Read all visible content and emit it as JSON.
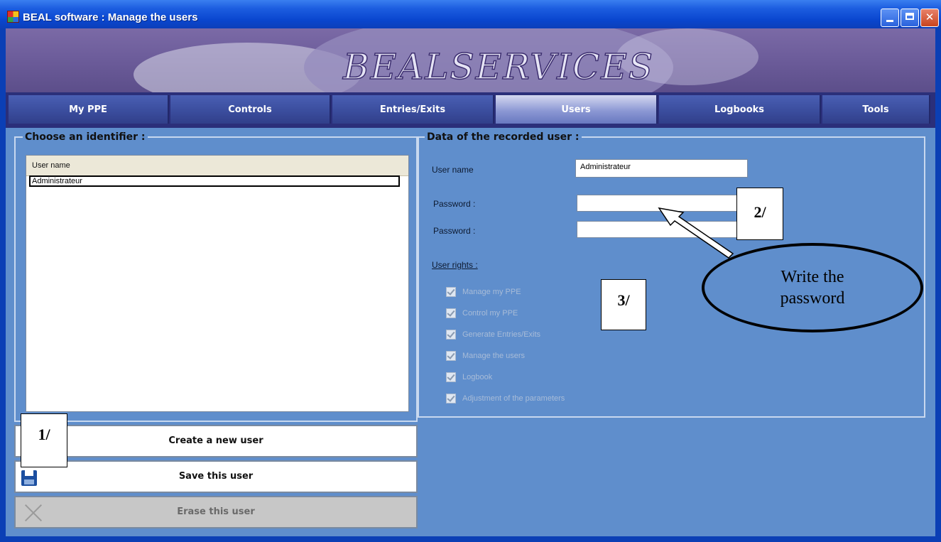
{
  "window": {
    "title": "BEAL software : Manage the users"
  },
  "banner": {
    "logo_text": "BEALSERVICES"
  },
  "tabs": [
    {
      "label": "My PPE",
      "active": false
    },
    {
      "label": "Controls",
      "active": false
    },
    {
      "label": "Entries/Exits",
      "active": false
    },
    {
      "label": "Users",
      "active": true
    },
    {
      "label": "Logbooks",
      "active": false
    },
    {
      "label": "Tools",
      "active": false
    }
  ],
  "identifier_panel": {
    "title": "Choose an identifier :",
    "column_header": "User name",
    "rows": [
      "Administrateur"
    ]
  },
  "user_panel": {
    "title": "Data of the recorded user :",
    "username_label": "User name",
    "username_value": "Administrateur",
    "password_label": "Password :",
    "password_confirm_label": "Password :",
    "password_value": "",
    "password_confirm_value": "",
    "rights_label": "User rights :",
    "rights": [
      {
        "label": "Manage my PPE",
        "checked": true
      },
      {
        "label": "Control my PPE",
        "checked": true
      },
      {
        "label": "Generate Entries/Exits",
        "checked": true
      },
      {
        "label": "Manage the users",
        "checked": true
      },
      {
        "label": "Logbook",
        "checked": true
      },
      {
        "label": "Adjustment of the parameters",
        "checked": true
      }
    ]
  },
  "actions": {
    "create_label": "Create a new user",
    "save_label": "Save this user",
    "erase_label": "Erase this user"
  },
  "annotations": {
    "step1": "1/",
    "step2": "2/",
    "step3": "3/",
    "callout_line1": "Write the",
    "callout_line2": "password"
  },
  "colors": {
    "titlebar": "#0a46cf",
    "content_bg": "#5f8ecc",
    "tab_bar": "#2b2f7a"
  }
}
